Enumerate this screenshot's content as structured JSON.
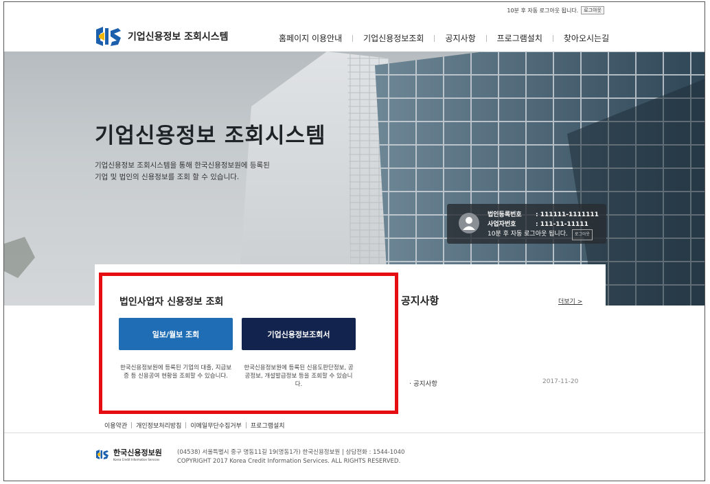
{
  "topbar": {
    "auto_logout_text": "10분 후 자동 로그아웃 됩니다.",
    "logout_label": "로그아웃"
  },
  "header": {
    "logo_text": "기업신용정보 조회시스템",
    "nav": [
      "홈페이지 이용안내",
      "기업신용정보조회",
      "공지사항",
      "프로그램설치",
      "찾아오시는길"
    ]
  },
  "hero": {
    "title": "기업신용정보 조회시스템",
    "desc_line1": "기업신용정보 조회시스템을 통해 한국신용정보원에 등록된",
    "desc_line2": "기업 및 법인의 신용정보를 조회 할 수 있습니다."
  },
  "user_info": {
    "corp_reg_label": "법인등록번호",
    "corp_reg_value": ": 111111-1111111",
    "biz_no_label": "사업자번호",
    "biz_no_value": ": 111-11-11111",
    "auto_logout_text": "10분 후 자동 로그아웃 됩니다.",
    "logout_label": "로그아웃"
  },
  "inquiry": {
    "title": "법인사업자 신용정보 조회",
    "button1": "일보/월보 조회",
    "button2": "기업신용정보조회서",
    "desc1": "한국신용정보원에 등록된 기업의 대출, 지급보증 등 신용공여 현황을 조회할 수 있습니다.",
    "desc2": "한국신용정보원에 등록된 신용도판단정보, 공공정보, 개설발급정보 등을 조회할 수 있습니다."
  },
  "notice": {
    "title": "공지사항",
    "more_label": "더보기 >",
    "items": [
      {
        "title": "· 공지사항",
        "date": "2017-11-20"
      }
    ]
  },
  "footer": {
    "links": [
      "이용약관",
      "개인정보처리방침",
      "이메일무단수집거부",
      "프로그램설치"
    ],
    "org_name": "한국신용정보원",
    "org_sub": "Korea Credit Information Services",
    "address": "(04538) 서울특별시 중구 명동11길 19(명동1가) 한국신용정보원 | 상담전화 : 1544-1040",
    "copyright": "COPYRIGHT 2017 Korea Credit Information Services. ALL RIGHTS RESERVED."
  },
  "colors": {
    "primary_button": "#1f6db5",
    "secondary_button": "#12244e",
    "highlight": "#e60d12"
  }
}
